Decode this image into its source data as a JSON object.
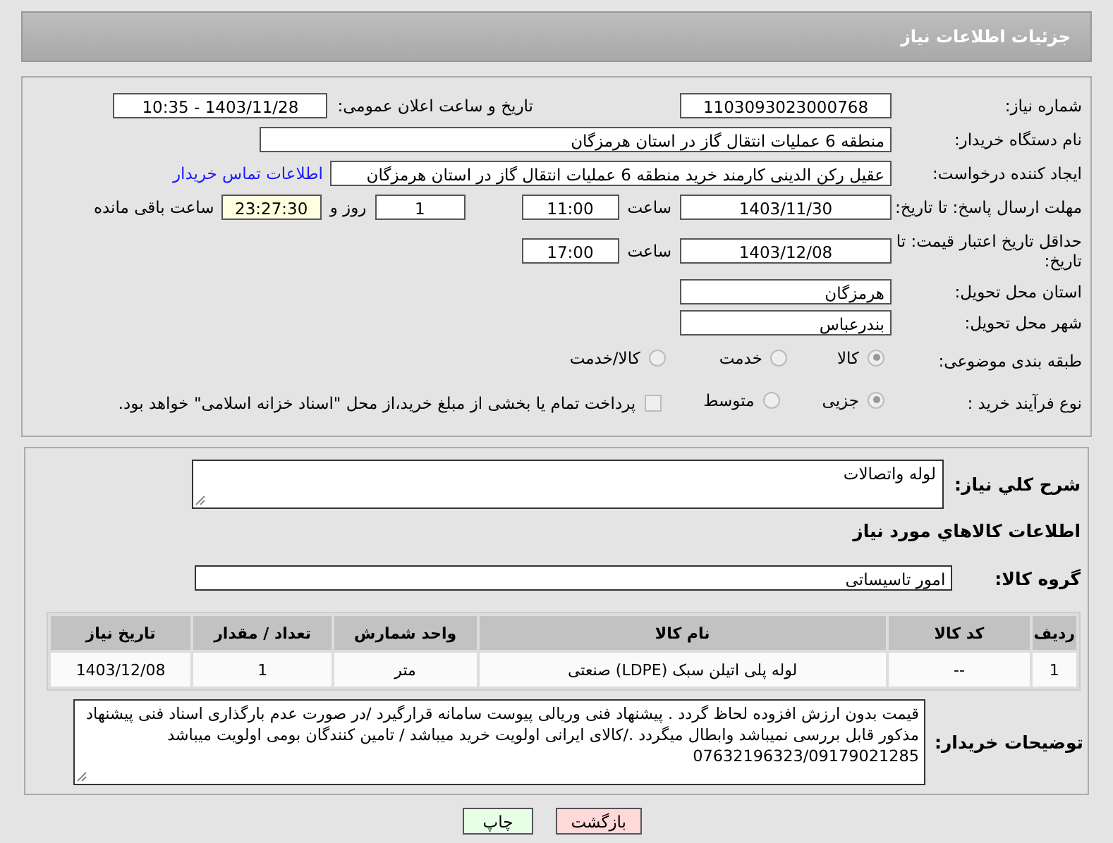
{
  "header": {
    "title": "جزئیات اطلاعات نیاز"
  },
  "need_number": {
    "label": "شماره نیاز:",
    "value": "1103093023000768"
  },
  "announce": {
    "label": "تاریخ و ساعت اعلان عمومی:",
    "value": "1403/11/28 - 10:35"
  },
  "buyer_org": {
    "label": "نام دستگاه خریدار:",
    "value": "منطقه 6 عملیات انتقال گاز در استان هرمزگان"
  },
  "requester": {
    "label": "ایجاد کننده درخواست:",
    "value": "عقیل رکن الدینی کارمند خرید منطقه 6 عملیات انتقال گاز در استان هرمزگان",
    "link": "اطلاعات تماس خریدار"
  },
  "reply_deadline": {
    "label": "مهلت ارسال پاسخ: تا تاریخ:",
    "date": "1403/11/30",
    "time_label": "ساعت",
    "time": "11:00",
    "days": "1",
    "days_label": "روز و",
    "remaining": "23:27:30",
    "remaining_label": "ساعت باقی مانده"
  },
  "price_validity": {
    "label": "حداقل تاریخ اعتبار قیمت: تا تاریخ:",
    "date": "1403/12/08",
    "time_label": "ساعت",
    "time": "17:00"
  },
  "province": {
    "label": "استان محل تحویل:",
    "value": "هرمزگان"
  },
  "city": {
    "label": "شهر محل تحویل:",
    "value": "بندرعباس"
  },
  "category": {
    "label": "طبقه بندی موضوعی:",
    "options": [
      {
        "label": "کالا",
        "selected": true
      },
      {
        "label": "خدمت",
        "selected": false
      },
      {
        "label": "کالا/خدمت",
        "selected": false
      }
    ]
  },
  "process": {
    "label": "نوع فرآیند خرید :",
    "options": [
      {
        "label": "جزیی",
        "selected": true
      },
      {
        "label": "متوسط",
        "selected": false
      }
    ],
    "treasury": {
      "label": "پرداخت تمام یا بخشی از مبلغ خرید،از محل \"اسناد خزانه اسلامی\" خواهد بود.",
      "checked": false
    }
  },
  "description": {
    "label": "شرح کلي نياز:",
    "value": "لوله واتصالات"
  },
  "goods_heading": "اطلاعات کالاهاي مورد نياز",
  "goods_group": {
    "label": "گروه کالا:",
    "value": "امور تاسیساتی"
  },
  "table": {
    "columns": [
      "ردیف",
      "کد کالا",
      "نام کالا",
      "واحد شمارش",
      "تعداد / مقدار",
      "تاریخ نیاز"
    ],
    "rows": [
      [
        "1",
        "--",
        "لوله پلی اتیلن سبک (LDPE) صنعتی",
        "متر",
        "1",
        "1403/12/08"
      ]
    ]
  },
  "buyer_notes": {
    "label": "توضیحات خریدار:",
    "value": "قیمت بدون ارزش افزوده لحاظ گردد . پیشنهاد فنی وریالی پیوست سامانه قرارگیرد /در صورت عدم بارگذاری اسناد فنی پیشنهاد مذکور قابل بررسی نمیباشد وابطال میگردد ./کالای ایرانی اولویت خرید میباشد / تامین کنندگان بومی اولویت میباشد 07632196323/09179021285"
  },
  "buttons": [
    {
      "label": "بازگشت",
      "kind": "back"
    },
    {
      "label": "چاپ",
      "kind": "print"
    }
  ]
}
